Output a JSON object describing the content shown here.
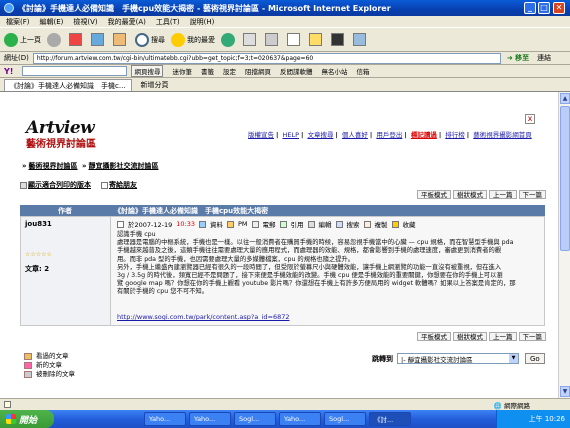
{
  "window": {
    "title": "《討論》手機達人必備知識　手機cpu效能大揭密 - 藝術視界討論區 - Microsoft Internet Explorer",
    "min": "_",
    "max": "□",
    "close": "✕"
  },
  "menu": [
    "檔案(F)",
    "編輯(E)",
    "檢視(V)",
    "我的最愛(A)",
    "工具(T)",
    "說明(H)"
  ],
  "toolbar": {
    "back": "上一頁",
    "search": "搜尋",
    "favorites": "我的最愛"
  },
  "address": {
    "label": "網址(D)",
    "url": "http://forum.artview.com.tw/cgi-bin/ultimatebb.cgi?ubb=get_topic;f=3;t=020637&page=60",
    "go": "移至",
    "links": "連結"
  },
  "yahoo": {
    "logo": "Y!",
    "search_btn": "網頁搜尋",
    "items": [
      "迷你筆",
      "書籤",
      "設定",
      "阻擋網頁",
      "反間諜軟體",
      "無名小站",
      "信箱"
    ]
  },
  "tabs": [
    {
      "label": "《討論》手機達人必備知識　手機c..."
    },
    {
      "label": "新增分頁"
    }
  ],
  "site": {
    "logo_top": "Artview",
    "logo_bottom": "藝術視界討論區"
  },
  "toplinks": [
    "版權宣告",
    "HELP",
    "文章搜尋",
    "個人喜好",
    "用戶登出",
    "標記讀過",
    "排行榜",
    "藝術視界攝影網首頁"
  ],
  "breadcrumb": [
    "藝術視界討論區",
    "靜宜攝影社交流討論區"
  ],
  "actions": {
    "print": "顯示適合列印的版本",
    "email": "寄給朋友"
  },
  "pager": [
    "平板模式",
    "樹狀模式",
    "上一篇",
    "下一篇"
  ],
  "table": {
    "col_author": "作者",
    "col_topic": "《討論》手機達人必備知識　手機cpu效能大揭密"
  },
  "post": {
    "author": "jou831",
    "stars": "☆☆☆☆☆",
    "count_label": "文章: 2",
    "date": "於2007-12-19",
    "time": "10:33",
    "meta": [
      "資料",
      "PM",
      "電郵",
      "引用",
      "編輯",
      "搜索",
      "複製",
      "收藏"
    ],
    "body": [
      "認識手機 cpu",
      "處理器是電腦的中樞系統，手機也是一樣。以往一般消費者在購買手機的時候，容易忽視手機當中的心臟 — cpu 規格，而在智慧型手機與 pda",
      "手機越來越普及之後，這類手機往往需要處理大量的應用程式，而處理器的效能、規格，都會影響到手機的處理速度，審處更到消費者的觀",
      "用。而非 pda 型的手機，也因需要處理大量的多媒體檔案，cpu 的規格也隨之提升。",
      "另外，手機上繼盛內建瀏覽器已經有很久的一段時間了，但受限於螢幕尺小與硬體效能，讓手機上網瀏覽的功能一直沒有被重視，但在進入",
      "3g / 3.5g 的時代後，頻寬已經不是問題了，接下來便是手機效能的改變。手機 cpu 便是手機效能的重要關鍵，你想要在你的手機上可以瀏",
      "覽 google map 嗎？你想在你的手機上觀看 youtube 影片嗎？你還想在手機上有許多方便局用的 widget 軟體嗎？如果以上答案是肯定的，那",
      "有關於手機的 cpu 您不可不知。"
    ],
    "link": "http://www.sogi.com.tw/park/content.asp?a_id=6872"
  },
  "legend": [
    "看過的文章",
    "新的文章",
    "被刪除的文章"
  ],
  "jump": {
    "label": "跳轉到",
    "selected": "|- 靜宜攝影社交流討論區",
    "go": "Go"
  },
  "status": {
    "zone": "網際網路"
  },
  "taskbar": {
    "start": "開始",
    "tasks": [
      "Yaho...",
      "Yaho...",
      "Sogl...",
      "Yaho...",
      "Sogl...",
      "《討..."
    ],
    "clock": "上午 10:26"
  }
}
